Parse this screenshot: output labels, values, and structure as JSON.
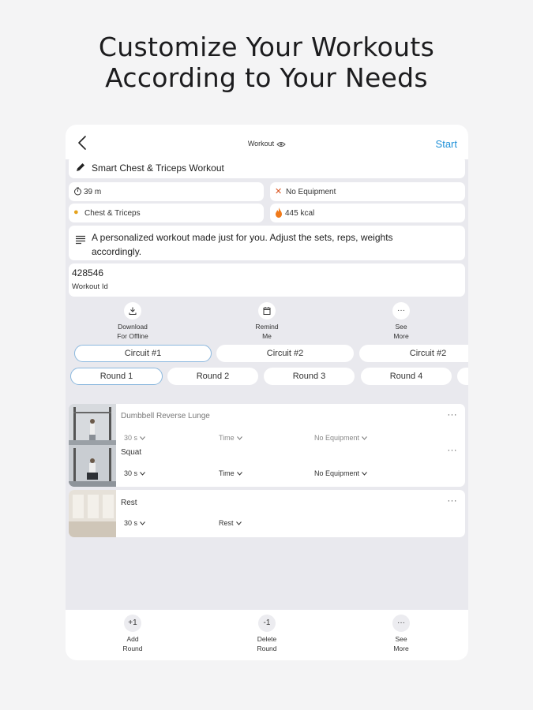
{
  "headline": {
    "line1": "Customize Your Workouts",
    "line2": "According to Your Needs"
  },
  "topbar": {
    "title": "Workout",
    "start_label": "Start"
  },
  "workout": {
    "name": "Smart Chest & Triceps Workout",
    "duration": "39 m",
    "equipment": "No Equipment",
    "muscles": "Chest & Triceps",
    "calories": "445 kcal",
    "description": "A personalized workout made just for you. Adjust the sets, reps, weights accordingly.",
    "id_value": "428546",
    "id_label": "Workout Id"
  },
  "actions": [
    {
      "icon": "download-icon",
      "line1": "Download",
      "line2": "For Offline"
    },
    {
      "icon": "calendar-icon",
      "line1": "Remind",
      "line2": "Me"
    },
    {
      "icon": "more-icon",
      "line1": "See",
      "line2": "More"
    }
  ],
  "circuits": [
    "Circuit #1",
    "Circuit #2",
    "Circuit #2"
  ],
  "rounds": [
    "Round 1",
    "Round 2",
    "Round 3",
    "Round 4"
  ],
  "exercises": [
    {
      "name": "Dumbbell Reverse Lunge",
      "duration": "30 s",
      "type": "Time",
      "equipment": "No Equipment"
    },
    {
      "name": "Squat",
      "duration": "30 s",
      "type": "Time",
      "equipment": "No Equipment"
    },
    {
      "name": "Rest",
      "duration": "30 s",
      "type": "Rest"
    }
  ],
  "bottom_actions": [
    {
      "icon_text": "+1",
      "line1": "Add",
      "line2": "Round"
    },
    {
      "icon_text": "-1",
      "line1": "Delete",
      "line2": "Round"
    },
    {
      "icon_text": "···",
      "line1": "See",
      "line2": "More"
    }
  ],
  "colors": {
    "accent": "#1e90d8",
    "selected_border": "#8bb8de",
    "background": "#e9e9ee"
  }
}
